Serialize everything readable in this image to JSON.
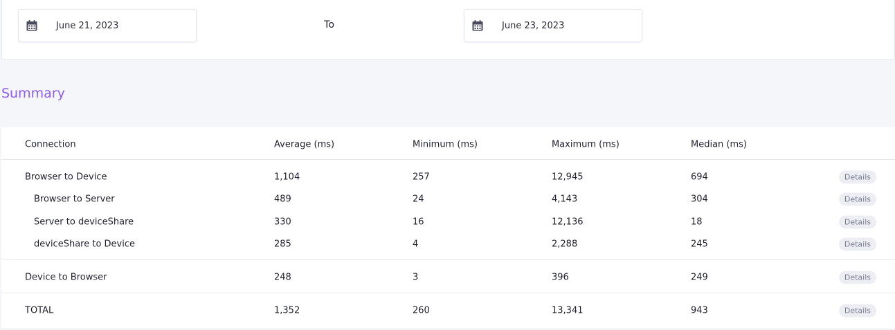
{
  "date_range": {
    "start_date": "June 21, 2023",
    "separator": "To",
    "end_date": "June 23, 2023"
  },
  "summary": {
    "title": "Summary",
    "columns": [
      "Connection",
      "Average (ms)",
      "Minimum (ms)",
      "Maximum (ms)",
      "Median (ms)"
    ],
    "rows": [
      {
        "connection": "Browser to Device",
        "average": "1,104",
        "minimum": "257",
        "maximum": "12,945",
        "median": "694",
        "details": "Details"
      },
      {
        "connection": "Browser to Server",
        "average": "489",
        "minimum": "24",
        "maximum": "4,143",
        "median": "304",
        "details": "Details"
      },
      {
        "connection": "Server to deviceShare",
        "average": "330",
        "minimum": "16",
        "maximum": "12,136",
        "median": "18",
        "details": "Details"
      },
      {
        "connection": "deviceShare to Device",
        "average": "285",
        "minimum": "4",
        "maximum": "2,288",
        "median": "245",
        "details": "Details"
      },
      {
        "connection": "Device to Browser",
        "average": "248",
        "minimum": "3",
        "maximum": "396",
        "median": "249",
        "details": "Details"
      },
      {
        "connection": "TOTAL",
        "average": "1,352",
        "minimum": "260",
        "maximum": "13,341",
        "median": "943",
        "details": "Details"
      }
    ]
  },
  "colors": {
    "accent": "#8b5cf6",
    "background": "#f5f6fa",
    "button_bg": "#eceef4"
  },
  "icons": {
    "date_field": "calendar-icon"
  }
}
